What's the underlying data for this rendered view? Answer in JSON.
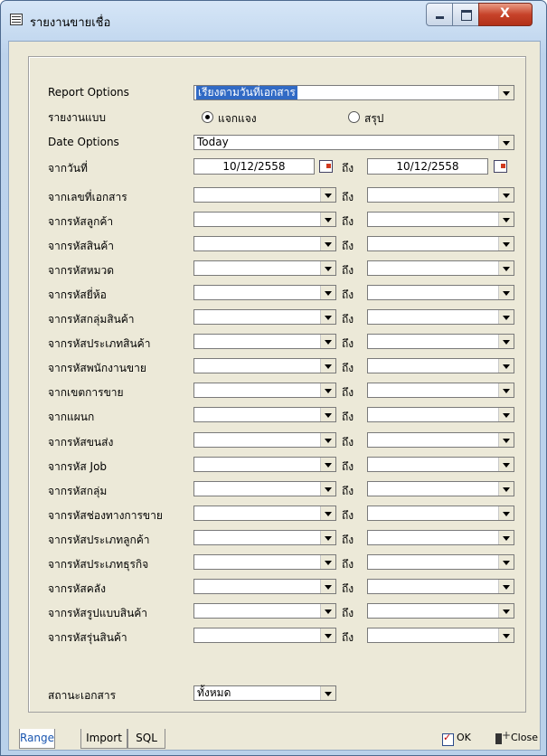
{
  "window": {
    "title": "รายงานขายเชื่อ"
  },
  "form": {
    "report_options": {
      "label": "Report Options",
      "value": "เรียงตามวันที่เอกสาร"
    },
    "report_type": {
      "label": "รายงานแบบ",
      "option_detail": "แจกแจง",
      "option_summary": "สรุป",
      "selected": "แจกแจง"
    },
    "date_options": {
      "label": "Date Options",
      "value": "Today"
    },
    "date_range": {
      "label": "จากวันที่",
      "from": "10/12/2558",
      "to": "10/12/2558",
      "to_label": "ถึง"
    },
    "ranges": [
      {
        "label": "จากเลขที่เอกสาร",
        "to_label": "ถึง"
      },
      {
        "label": "จากรหัสลูกค้า",
        "to_label": "ถึง"
      },
      {
        "label": "จากรหัสสินค้า",
        "to_label": "ถึง"
      },
      {
        "label": "จากรหัสหมวด",
        "to_label": "ถึง"
      },
      {
        "label": "จากรหัสยี่ห้อ",
        "to_label": "ถึง"
      },
      {
        "label": "จากรหัสกลุ่มสินค้า",
        "to_label": "ถึง"
      },
      {
        "label": "จากรหัสประเภทสินค้า",
        "to_label": "ถึง"
      },
      {
        "label": "จากรหัสพนักงานขาย",
        "to_label": "ถึง"
      },
      {
        "label": "จากเขตการขาย",
        "to_label": "ถึง"
      },
      {
        "label": "จากแผนก",
        "to_label": "ถึง"
      },
      {
        "label": "จากรหัสขนส่ง",
        "to_label": "ถึง"
      },
      {
        "label": "จากรหัส Job",
        "to_label": "ถึง"
      },
      {
        "label": "จากรหัสกลุ่ม",
        "to_label": "ถึง"
      },
      {
        "label": "จากรหัสช่องทางการขาย",
        "to_label": "ถึง"
      },
      {
        "label": "จากรหัสประเภทลูกค้า",
        "to_label": "ถึง"
      },
      {
        "label": "จากรหัสประเภทธุรกิจ",
        "to_label": "ถึง"
      },
      {
        "label": "จากรหัสคลัง",
        "to_label": "ถึง"
      },
      {
        "label": "จากรหัสรูปแบบสินค้า",
        "to_label": "ถึง"
      },
      {
        "label": "จากรหัสรุ่นสินค้า",
        "to_label": "ถึง"
      }
    ],
    "doc_status": {
      "label": "สถานะเอกสาร",
      "value": "ทั้งหมด"
    }
  },
  "tabs": [
    "Range",
    "Import",
    "SQL"
  ],
  "footer": {
    "ok_label": "OK",
    "close_label": "Close"
  }
}
